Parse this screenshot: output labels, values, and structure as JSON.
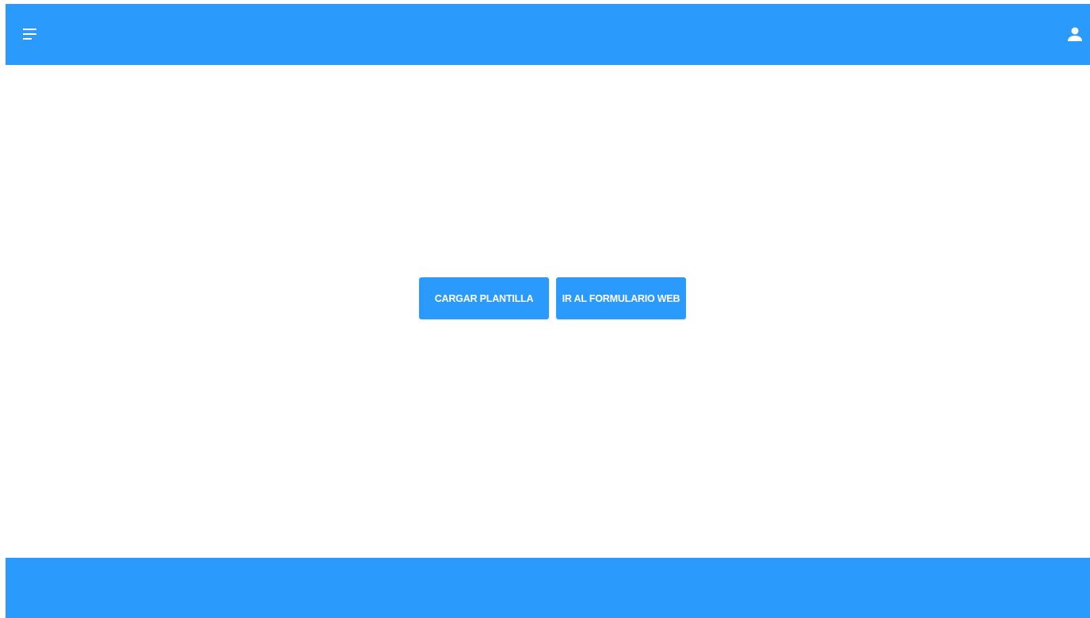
{
  "colors": {
    "primary": "#2a9bfc",
    "background": "#ffffff",
    "on_primary": "#ffffff"
  },
  "header": {
    "menu_icon": "menu-icon",
    "account_icon": "user-icon"
  },
  "main": {
    "actions": [
      {
        "label": "CARGAR PLANTILLA"
      },
      {
        "label": "IR AL FORMULARIO WEB"
      }
    ]
  },
  "footer": {}
}
